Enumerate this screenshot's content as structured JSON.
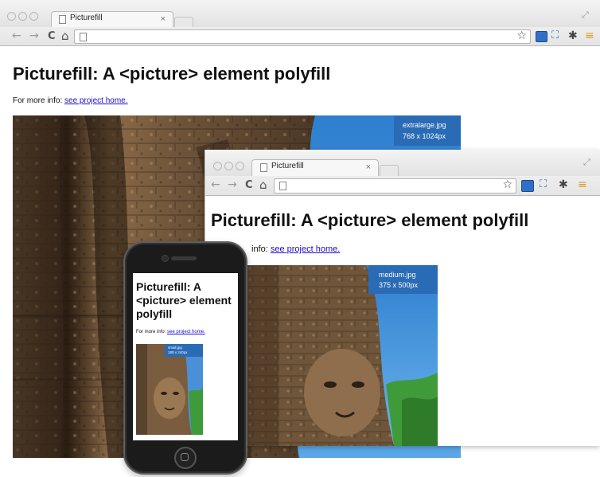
{
  "page": {
    "title": "Picturefill: A <picture> element polyfill",
    "info_prefix": "For more info:",
    "info_link": "see project home."
  },
  "browser_large": {
    "tab_title": "Picturefill",
    "tab_close": "×",
    "image_label_file": "extralarge.jpg",
    "image_label_dims": "768 x 1024px"
  },
  "browser_medium": {
    "tab_title": "Picturefill",
    "tab_close": "×",
    "info_prefix_visible": "info:",
    "image_label_file": "medium.jpg",
    "image_label_dims": "375 x 500px"
  },
  "phone": {
    "title": "Picturefill: A <picture> element polyfill",
    "info_prefix": "For more info:",
    "info_link": "see project home.",
    "image_label_file": "small.jpg",
    "image_label_dims": "180 x 240px"
  },
  "toolbar": {
    "back_icon": "←",
    "forward_icon": "→",
    "reload_icon": "C",
    "home_icon": "⌂",
    "star_icon": "☆",
    "fullscreen_icon": "⛶",
    "wrench_icon": "✱",
    "extension_icon": "≡"
  },
  "colors": {
    "link": "#1a0dcc",
    "label_bg": "#2a6bb5",
    "sky": "#3d8fd8",
    "stone_dark": "#3a2a1c",
    "stone_light": "#a37c57"
  }
}
